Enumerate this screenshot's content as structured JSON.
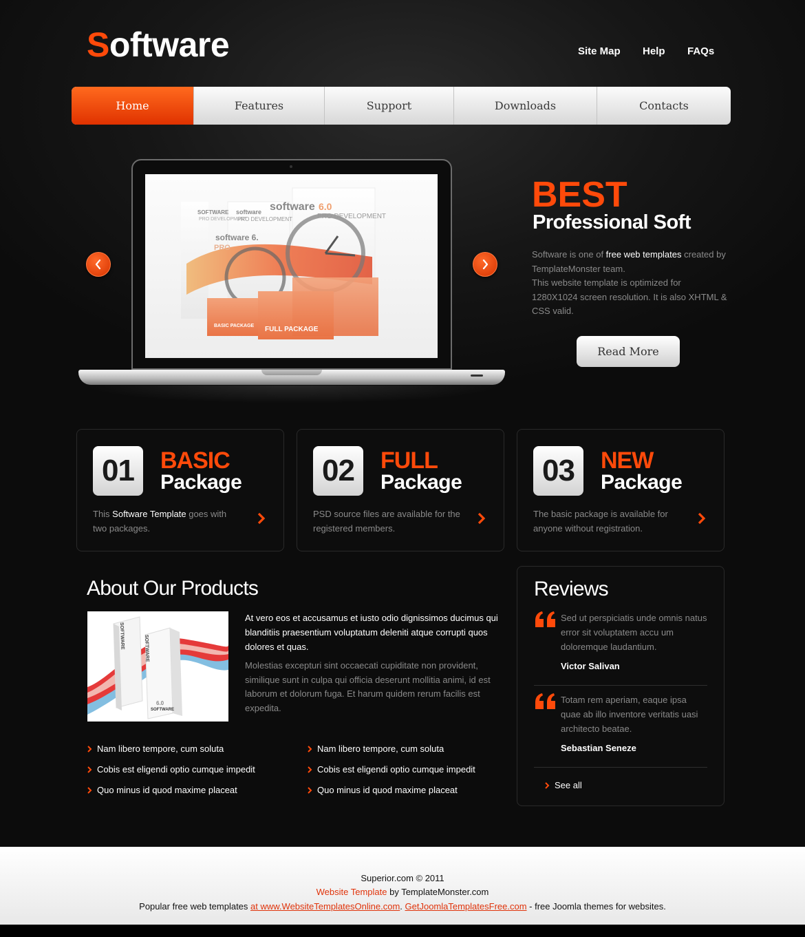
{
  "header": {
    "logo_first_letter": "S",
    "logo_rest": "oftware",
    "links": [
      "Site Map",
      "Help",
      "FAQs"
    ]
  },
  "menu": {
    "items": [
      "Home",
      "Features",
      "Support",
      "Downloads",
      "Contacts"
    ],
    "active": "Home"
  },
  "hero": {
    "title_1": "BEST",
    "title_2": "Professional Soft",
    "text_1": "Software is one of ",
    "text_hl": "free web templates",
    "text_2": " created by TemplateMonster team.",
    "text_3": "This website template is optimized for 1280X1024 screen resolution. It is also XHTML & CSS valid.",
    "read_more": "Read More",
    "slide_labels": {
      "box_1": "SOFTWARE",
      "box_1b": "PRO DEVELOPMENT",
      "box_2": "software",
      "box_2b": "PRO DEVELOPMENT",
      "big": "software",
      "version": "6.0",
      "small_1": "software 6.",
      "small_2": "PRO",
      "basic": "BASIC PACKAGE",
      "full": "FULL PACKAGE"
    }
  },
  "packages": [
    {
      "num": "01",
      "t1": "BASIC",
      "t2": "Package",
      "desc_1": "This ",
      "desc_hl": "Software Template",
      "desc_2": " goes with two packages."
    },
    {
      "num": "02",
      "t1": "FULL",
      "t2": "Package",
      "desc_1": "PSD source files are available for the registered members.",
      "desc_hl": "",
      "desc_2": ""
    },
    {
      "num": "03",
      "t1": "NEW",
      "t2": "Package",
      "desc_1": "The basic package is available for anyone without registration.",
      "desc_hl": "",
      "desc_2": ""
    }
  ],
  "about": {
    "title": "About Our Products",
    "lead": "At vero eos et accusamus et iusto odio dignissimos ducimus qui blanditiis praesentium voluptatum deleniti atque corrupti quos dolores et quas.",
    "body": "Molestias excepturi sint occaecati cupiditate non provident, similique sunt in culpa qui officia deserunt mollitia animi, id est laborum et dolorum fuga. Et harum quidem rerum facilis est expedita.",
    "image_box_label": "SOFTWARE",
    "image_box_version": "6.0",
    "list_left": [
      "Nam libero tempore, cum soluta",
      "Cobis est eligendi optio cumque impedit",
      "Quo minus id quod maxime placeat"
    ],
    "list_right": [
      "Nam libero tempore, cum soluta",
      "Cobis est eligendi optio cumque impedit",
      "Quo minus id quod maxime placeat"
    ]
  },
  "reviews": {
    "title": "Reviews",
    "items": [
      {
        "text": "Sed ut perspiciatis unde omnis natus error sit voluptatem accu um doloremque laudantium.",
        "author": "Victor Salivan"
      },
      {
        "text": "Totam rem aperiam, eaque ipsa quae ab illo inventore veritatis uasi architecto beatae.",
        "author": "Sebastian Seneze"
      }
    ],
    "see_all": "See all"
  },
  "footer": {
    "copyright": "Superior.com © 2011",
    "wt_link": "Website Template",
    "wt_by": " by TemplateMonster.com",
    "popular_1": "Popular free web templates ",
    "link_1": "at www.WebsiteTemplatesOnline.com",
    "link_sep": ". ",
    "link_2": "GetJoomlaTemplatesFree.com",
    "popular_2": " - free Joomla themes for websites."
  },
  "colors": {
    "accent": "#ff4a0a",
    "background": "#0d0d0d",
    "text_muted": "#8a8a8a"
  }
}
